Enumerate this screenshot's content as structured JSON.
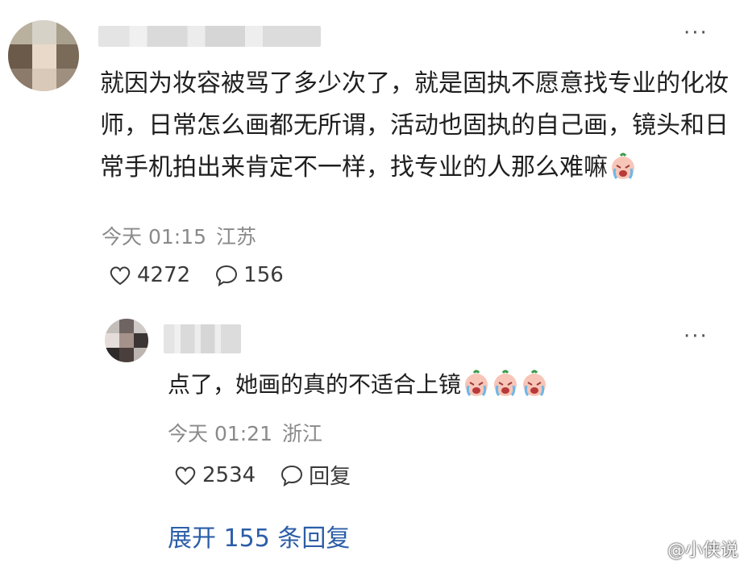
{
  "main_comment": {
    "avatar_icon": "avatar-icon",
    "text": "就因为妆容被骂了多少次了，就是固执不愿意找专业的化妆师，日常怎么画都无所谓，活动也固执的自己画，镜头和日常手机拍出来肯定不一样，找专业的人那么难嘛",
    "emoji": "crying-face-icon",
    "time": "今天 01:15",
    "location": "江苏",
    "likes": "4272",
    "comments": "156"
  },
  "reply": {
    "avatar_icon": "avatar-icon",
    "text": "点了，她画的真的不适合上镜",
    "emojis": [
      "crying-face-icon",
      "crying-face-icon",
      "crying-face-icon"
    ],
    "time": "今天 01:21",
    "location": "浙江",
    "likes": "2534",
    "reply_label": "回复"
  },
  "expand_label": "展开 155 条回复",
  "watermark": "@小侠说",
  "colors": {
    "link": "#2c5ea8",
    "meta": "#8a8a8a",
    "text": "#1f1f1f"
  }
}
